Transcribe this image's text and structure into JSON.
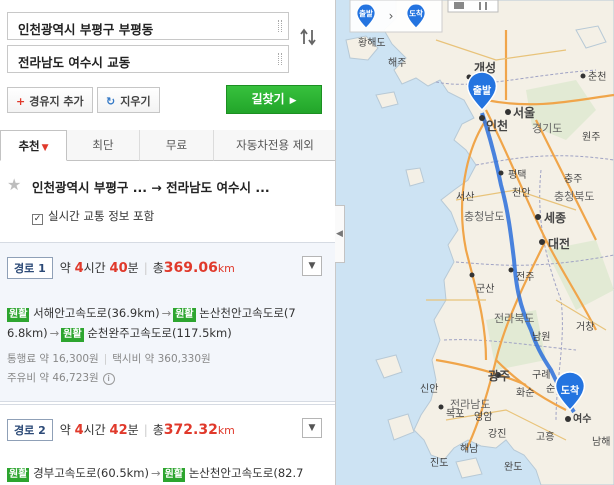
{
  "search": {
    "start_address": "인천광역시 부평구 부평동",
    "end_address": "전라남도 여수시 교동",
    "swap_icon": "swap-arrows-icon",
    "waypoint_label": "경유지 추가",
    "clear_label": "지우기",
    "search_label": "길찾기"
  },
  "tabs": [
    {
      "label": "추천",
      "active": true
    },
    {
      "label": "최단",
      "active": false
    },
    {
      "label": "무료",
      "active": false
    },
    {
      "label": "자동차전용 제외",
      "active": false
    }
  ],
  "summary": {
    "text": "인천광역시 부평구 ... → 전라남도 여수시 ...",
    "realtime_label": "실시간 교통 정보 포함",
    "realtime_checked": true
  },
  "routes": [
    {
      "badge": "경로 1",
      "time_prefix": "약 ",
      "hours": "4",
      "hours_unit": "시간 ",
      "minutes": "40",
      "minutes_unit": "분",
      "dist_prefix": "총",
      "distance": "369.06",
      "dist_unit": "km",
      "road_tag": "원활",
      "road1": "서해안고속도로(36.9km)",
      "road2a": "논산천안고속도로(7",
      "road2b": "6.8km)",
      "road3": "순천완주고속도로(117.5km)",
      "cost1": "통행료 약 16,300원",
      "cost2": "택시비 약 360,330원",
      "cost3": "주유비 약 46,723원"
    },
    {
      "badge": "경로 2",
      "time_prefix": "약 ",
      "hours": "4",
      "hours_unit": "시간 ",
      "minutes": "42",
      "minutes_unit": "분",
      "dist_prefix": "총",
      "distance": "372.32",
      "dist_unit": "km",
      "road_tag": "원활",
      "road1": "경부고속도로(60.5km)",
      "road2a": "논산천안고속도로(82.7"
    }
  ],
  "map": {
    "start_marker": "출발",
    "end_marker": "도착",
    "legend_start": "출발",
    "legend_end": "도착",
    "labels": {
      "hwanghae": "황해도",
      "haeju": "해주",
      "gaeseong": "개성",
      "chuncheon": "춘천",
      "seoul": "서울",
      "incheon": "인천",
      "gyeonggi": "경기도",
      "wonju": "원주",
      "pyeongtaek": "평택",
      "chungju": "충주",
      "chungbuk": "충청북도",
      "seosan": "서산",
      "cheonan": "천안",
      "chungnam": "충청남도",
      "sejong": "세종",
      "daejeon": "대전",
      "gunsan": "군산",
      "jeonju": "전주",
      "jeonbuk": "전라북도",
      "namwon": "남원",
      "gwangju": "광주",
      "jeonnam": "전라남도",
      "suncheon": "순천",
      "mokpo": "목포",
      "gangjin": "강진",
      "yeosu": "여수",
      "sinan": "신안",
      "hwasun": "화순",
      "gurye": "구례",
      "goheung": "고흥",
      "jindo": "진도",
      "namhae": "남해",
      "wando": "완도",
      "yeongam": "영암",
      "haenam": "해남",
      "geochang": "거창"
    }
  }
}
